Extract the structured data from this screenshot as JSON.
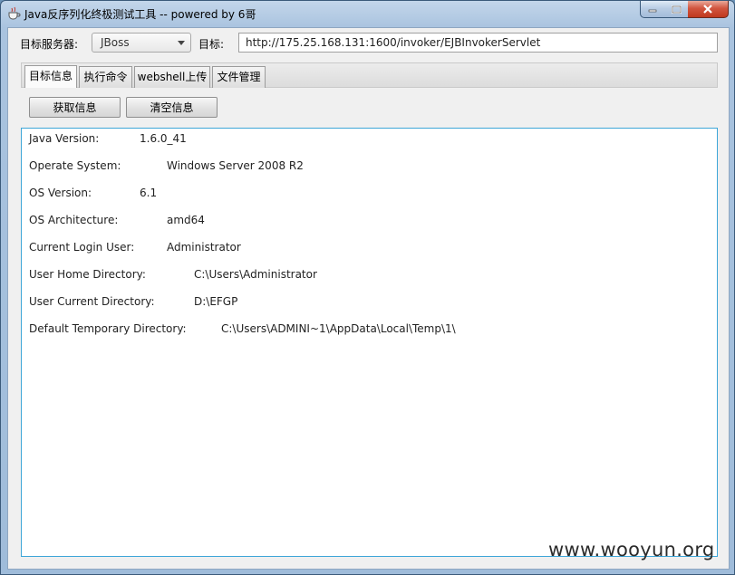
{
  "window": {
    "title": "Java反序列化终极测试工具  -- powered by 6哥"
  },
  "toolbar": {
    "server_label": "目标服务器:",
    "server_value": "JBoss",
    "target_label": "目标:",
    "target_url": "http://175.25.168.131:1600/invoker/EJBInvokerServlet"
  },
  "tabs": [
    {
      "label": "目标信息",
      "active": true
    },
    {
      "label": "执行命令",
      "active": false
    },
    {
      "label": "webshell上传",
      "active": false
    },
    {
      "label": "文件管理",
      "active": false
    }
  ],
  "buttons": {
    "get_info": "获取信息",
    "clear_info": "清空信息"
  },
  "info": [
    {
      "key": "Java Version:",
      "value": "1.6.0_41"
    },
    {
      "key": "Operate System:",
      "value": "Windows Server 2008 R2"
    },
    {
      "key": "OS Version:",
      "value": "6.1"
    },
    {
      "key": "OS Architecture:",
      "value": "amd64"
    },
    {
      "key": "Current Login User:",
      "value": "Administrator"
    },
    {
      "key": "User Home Directory:",
      "value": "C:\\Users\\Administrator"
    },
    {
      "key": "User Current Directory:",
      "value": "D:\\EFGP"
    },
    {
      "key": "Default Temporary Directory:",
      "value": "C:\\Users\\ADMINI~1\\AppData\\Local\\Temp\\1\\"
    }
  ],
  "watermark": "www.wooyun.org",
  "colors": {
    "accent_border": "#3ea6d8",
    "close_button": "#c0391e",
    "title_bar": "#a9c3df"
  }
}
